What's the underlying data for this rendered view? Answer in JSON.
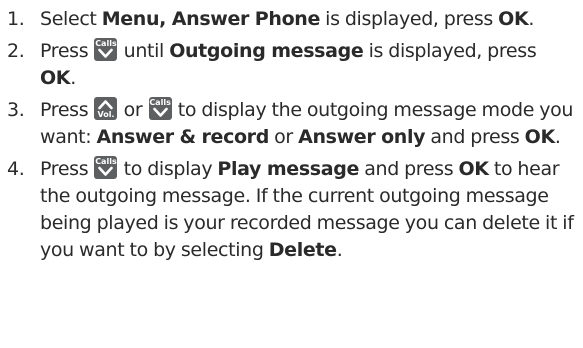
{
  "icons": {
    "calls_key": {
      "name": "calls-down-key-icon",
      "label": "Calls"
    },
    "vol_key": {
      "name": "vol-up-key-icon",
      "label": "Vol."
    }
  },
  "colors": {
    "text": "#2a2a2a",
    "key_background": "#5d5f61",
    "key_foreground": "#ffffff"
  },
  "steps": [
    {
      "number": "1.",
      "segments": [
        {
          "t": "text",
          "v": "Select "
        },
        {
          "t": "bold",
          "v": "Menu, Answer Phone"
        },
        {
          "t": "text",
          "v": " is displayed, press "
        },
        {
          "t": "bold",
          "v": "OK"
        },
        {
          "t": "text",
          "v": "."
        }
      ]
    },
    {
      "number": "2.",
      "segments": [
        {
          "t": "text",
          "v": "Press "
        },
        {
          "t": "icon",
          "v": "calls"
        },
        {
          "t": "text",
          "v": " until "
        },
        {
          "t": "bold",
          "v": "Outgoing message"
        },
        {
          "t": "text",
          "v": " is displayed, press "
        },
        {
          "t": "bold",
          "v": "OK"
        },
        {
          "t": "text",
          "v": "."
        }
      ]
    },
    {
      "number": "3.",
      "segments": [
        {
          "t": "text",
          "v": "Press "
        },
        {
          "t": "icon",
          "v": "vol"
        },
        {
          "t": "text",
          "v": " or "
        },
        {
          "t": "icon",
          "v": "calls"
        },
        {
          "t": "text",
          "v": " to display the outgoing message mode you want: "
        },
        {
          "t": "bold",
          "v": "Answer & record"
        },
        {
          "t": "text",
          "v": " or "
        },
        {
          "t": "bold",
          "v": "Answer only"
        },
        {
          "t": "text",
          "v": " and press "
        },
        {
          "t": "bold",
          "v": "OK"
        },
        {
          "t": "text",
          "v": "."
        }
      ]
    },
    {
      "number": "4.",
      "segments": [
        {
          "t": "text",
          "v": "Press "
        },
        {
          "t": "icon",
          "v": "calls"
        },
        {
          "t": "text",
          "v": " to display "
        },
        {
          "t": "bold",
          "v": "Play message"
        },
        {
          "t": "text",
          "v": " and press "
        },
        {
          "t": "bold",
          "v": "OK"
        },
        {
          "t": "text",
          "v": " to hear the outgoing message. If the current outgoing message being played is your recorded message you can delete it if you want to by selecting "
        },
        {
          "t": "bold",
          "v": "Delete"
        },
        {
          "t": "text",
          "v": "."
        }
      ]
    }
  ]
}
